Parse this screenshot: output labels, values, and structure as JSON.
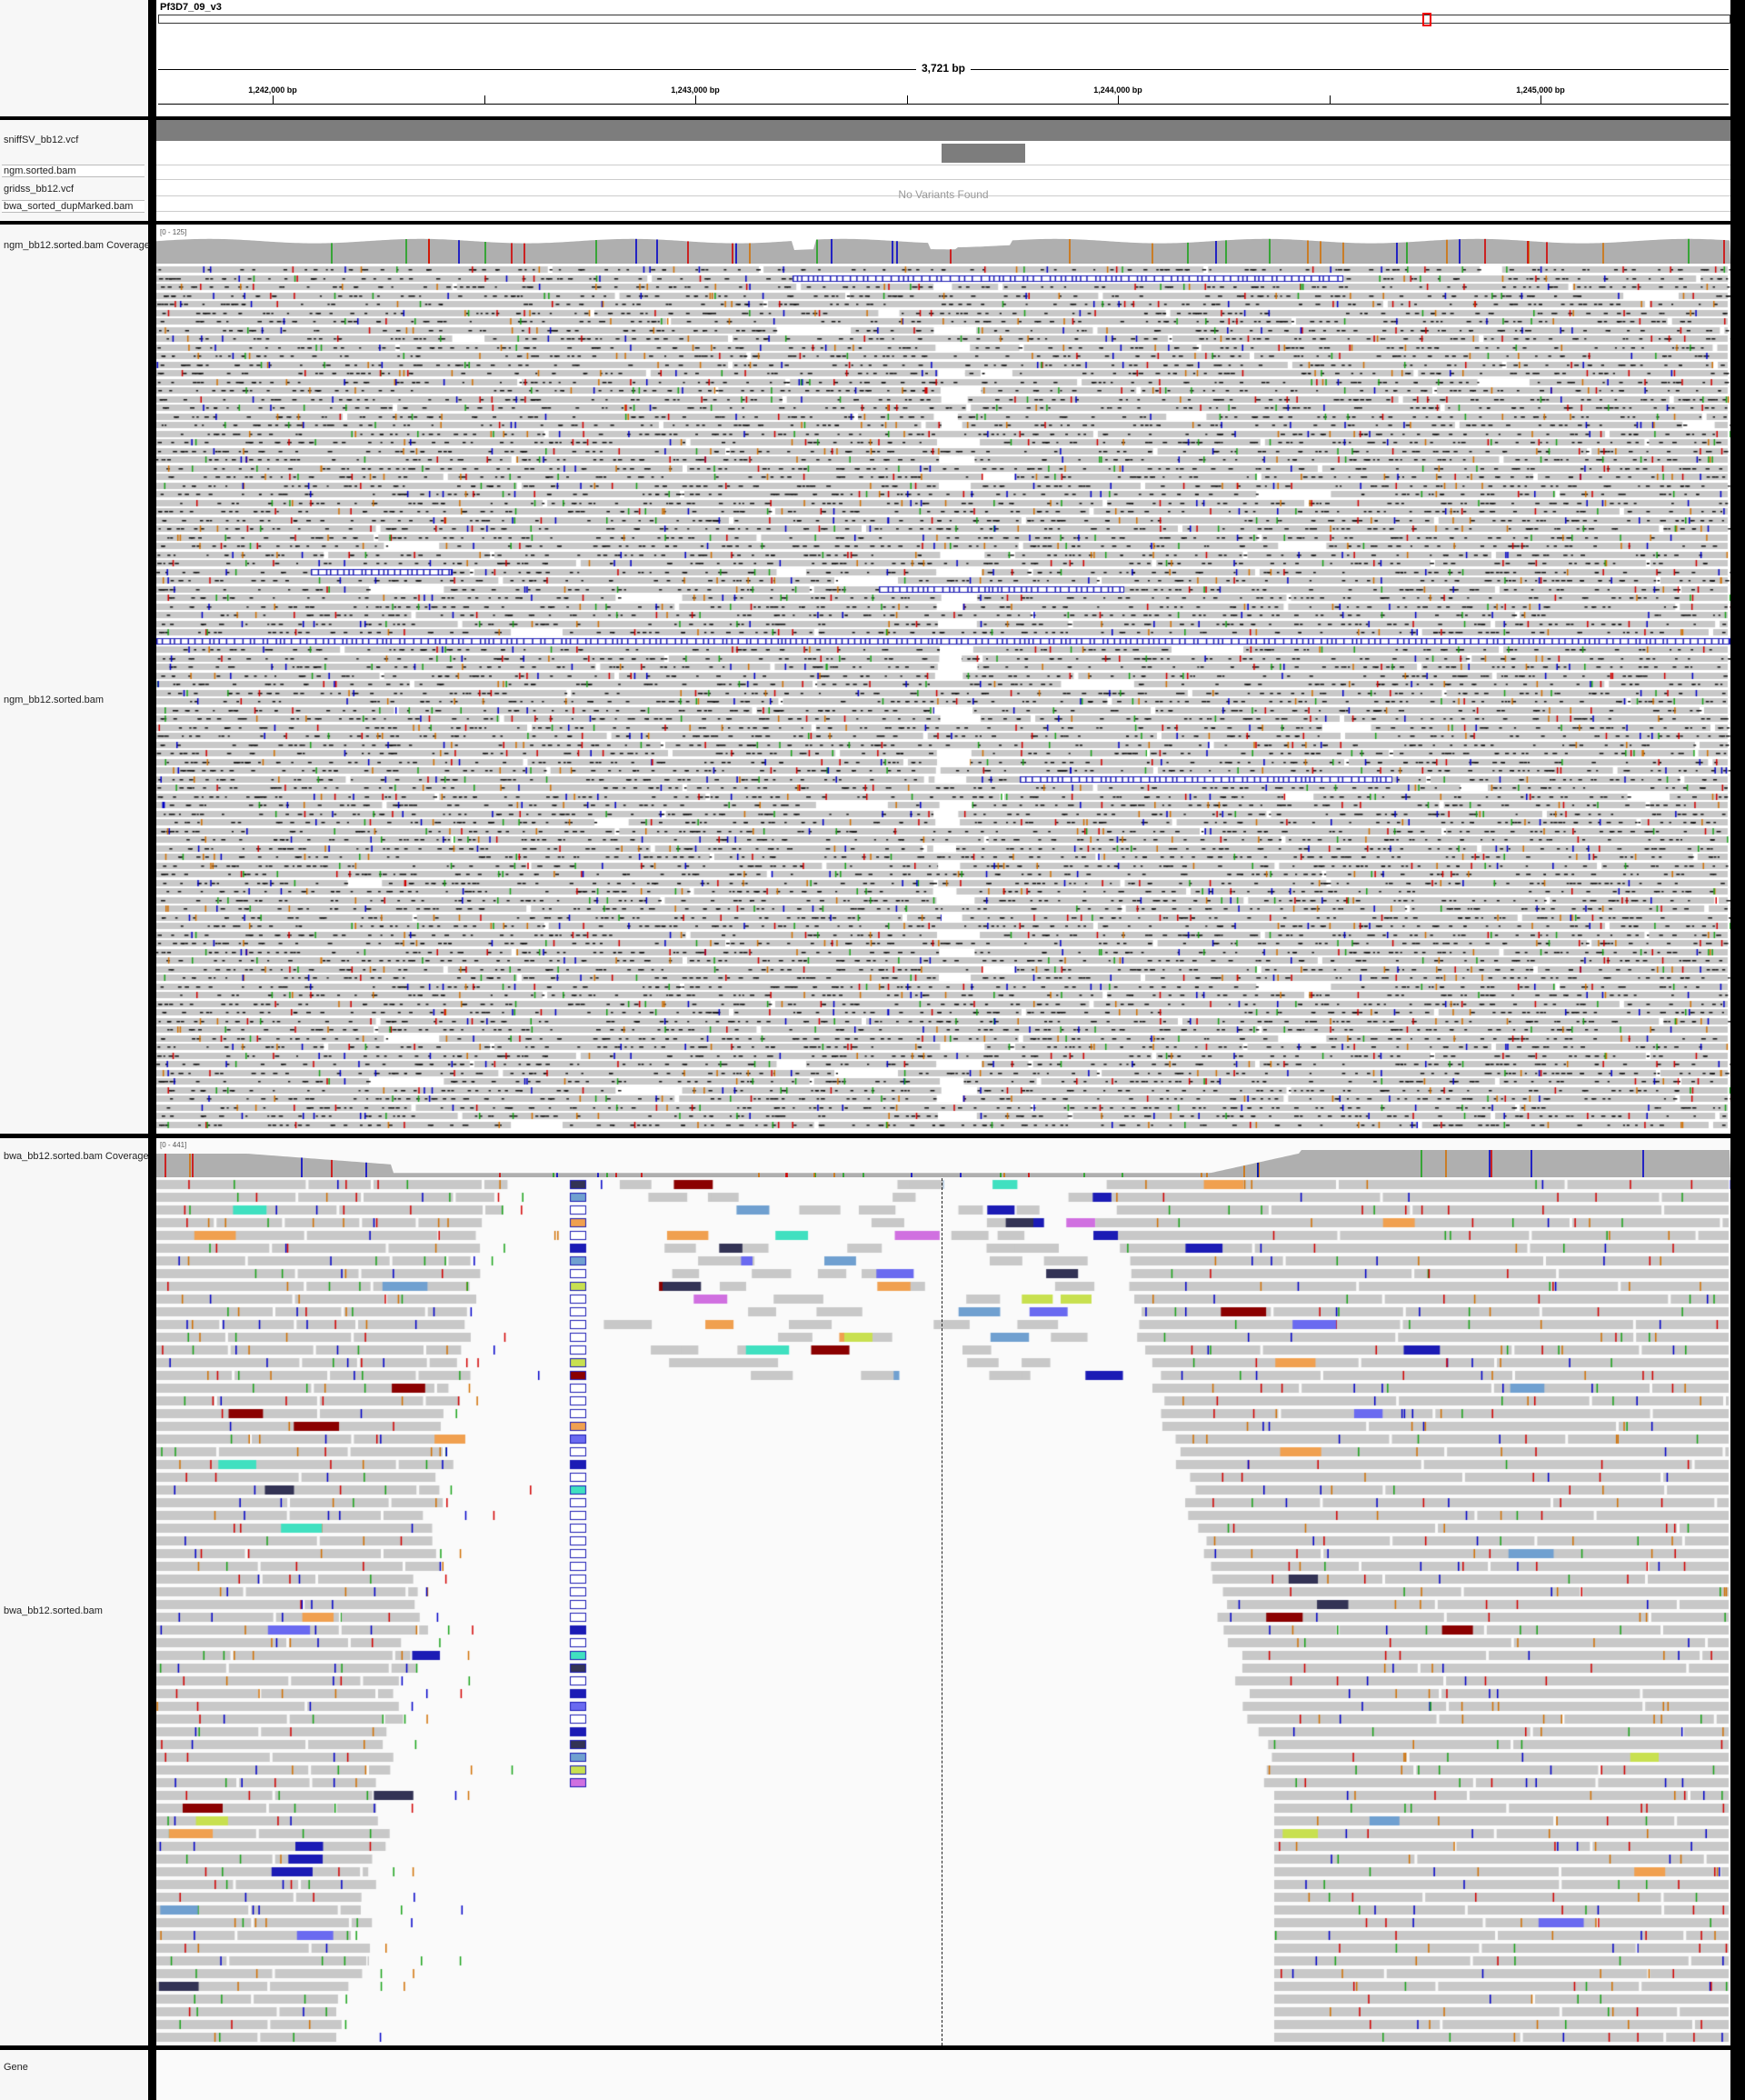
{
  "header": {
    "chromosome": "Pf3D7_09_v3",
    "span": "3,721 bp",
    "ticks": [
      "1,242,000 bp",
      "1,243,000 bp",
      "1,244,000 bp",
      "1,245,000 bp"
    ]
  },
  "tracks": {
    "vcf1": "sniffSV_bb12.vcf",
    "bam1": "ngm.sorted.bam",
    "vcf2": "gridss_bb12.vcf",
    "bam2": "bwa_sorted_dupMarked.bam",
    "no_variants": "No Variants Found",
    "ngm_coverage": "ngm_bb12.sorted.bam Coverage",
    "ngm_coverage_range": "[0 - 125]",
    "ngm_reads": "ngm_bb12.sorted.bam",
    "bwa_coverage": "bwa_bb12.sorted.bam Coverage",
    "bwa_coverage_range": "[0 - 441]",
    "bwa_reads": "bwa_bb12.sorted.bam",
    "gene": "Gene"
  },
  "colors": {
    "read": "#c8c8c8",
    "coverage": "#afafaf",
    "mismatch_A": "#1aa31a",
    "mismatch_C": "#0000c8",
    "mismatch_G": "#d17105",
    "mismatch_T": "#d20000",
    "insertion": "#7d22d6",
    "deletion_line": "#000000",
    "inversion": "#1b1bb5",
    "translocation_red": "#8b0000"
  }
}
